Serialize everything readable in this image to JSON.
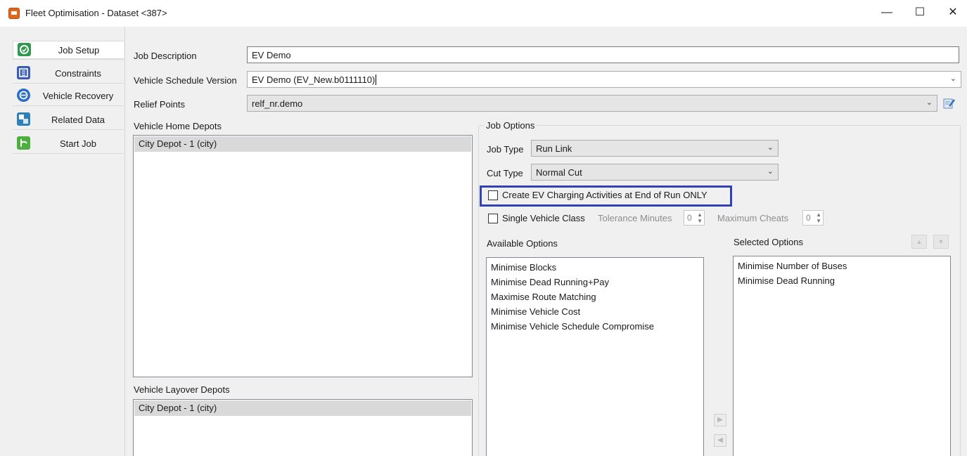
{
  "window": {
    "title": "Fleet Optimisation - Dataset <387>",
    "minimize_glyph": "—",
    "maximize_glyph": "☐",
    "close_glyph": "✕"
  },
  "nav": {
    "items": [
      {
        "label": "Job Setup",
        "icon": "job-setup-icon",
        "color": "#2f9a4f",
        "active": true
      },
      {
        "label": "Constraints",
        "icon": "constraints-icon",
        "color": "#3a5db0",
        "active": false
      },
      {
        "label": "Vehicle Recovery",
        "icon": "vehicle-recovery-icon",
        "color": "#2a6fc4",
        "active": false
      },
      {
        "label": "Related Data",
        "icon": "related-data-icon",
        "color": "#2f7fb8",
        "active": false
      },
      {
        "label": "Start Job",
        "icon": "start-job-icon",
        "color": "#4caf3f",
        "active": false
      }
    ]
  },
  "form": {
    "job_description_label": "Job Description",
    "job_description_value": "EV Demo",
    "vehicle_schedule_label": "Vehicle Schedule Version",
    "vehicle_schedule_value": "EV Demo (EV_New.b0111110)",
    "relief_points_label": "Relief Points",
    "relief_points_value": "relf_nr.demo"
  },
  "home_depots": {
    "label": "Vehicle Home Depots",
    "items": [
      "City Depot - 1 (city)"
    ]
  },
  "layover_depots": {
    "label": "Vehicle Layover Depots",
    "items": [
      "City Depot - 1 (city)"
    ]
  },
  "job_options": {
    "title": "Job Options",
    "job_type_label": "Job Type",
    "job_type_value": "Run Link",
    "cut_type_label": "Cut Type",
    "cut_type_value": "Normal Cut",
    "ev_charging_label": "Create EV Charging Activities at End of Run ONLY",
    "ev_charging_checked": false,
    "single_vehicle_class_label": "Single Vehicle Class",
    "single_vehicle_class_checked": false,
    "tolerance_minutes_label": "Tolerance Minutes",
    "tolerance_minutes_value": "0",
    "maximum_cheats_label": "Maximum Cheats",
    "maximum_cheats_value": "0",
    "available_label": "Available Options",
    "available_items": [
      "Minimise Blocks",
      "Minimise Dead Running+Pay",
      "Maximise Route Matching",
      "Minimise Vehicle Cost",
      "Minimise Vehicle Schedule Compromise"
    ],
    "selected_label": "Selected Options",
    "selected_items": [
      "Minimise Number of Buses",
      "Minimise Dead Running"
    ]
  },
  "colors": {
    "highlight": "#3440b5",
    "app_icon": "#e2661c"
  }
}
